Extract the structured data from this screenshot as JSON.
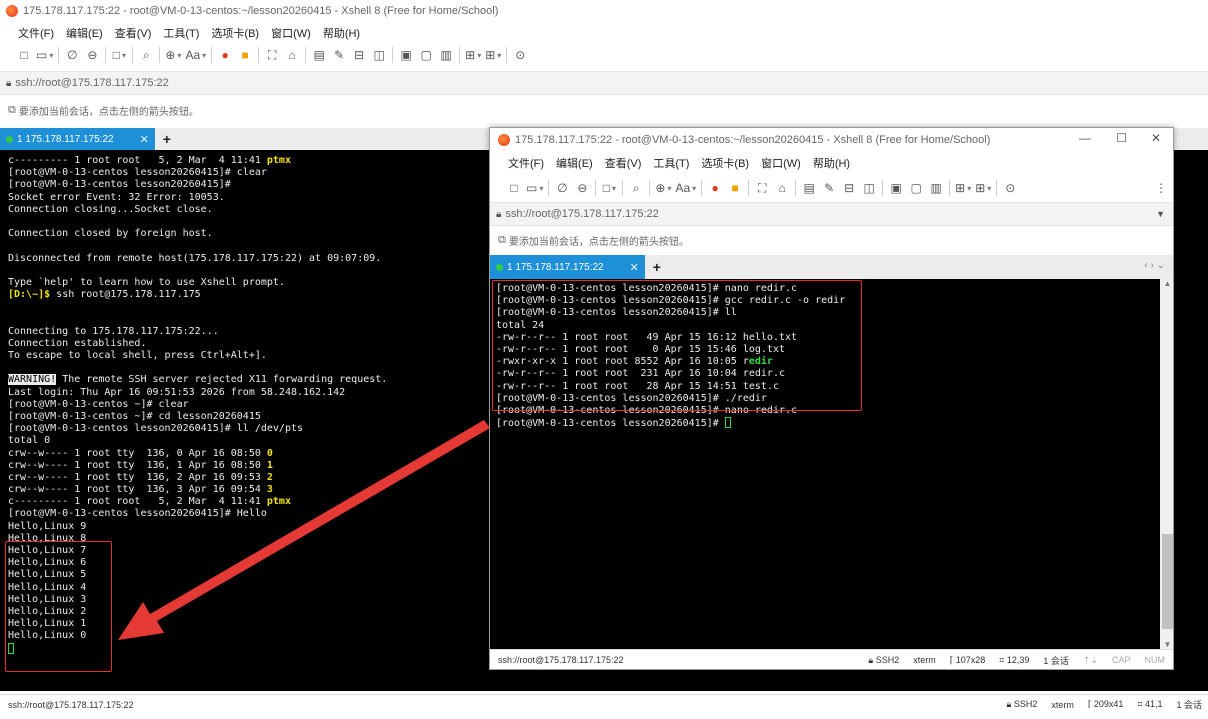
{
  "main_window": {
    "title": "175.178.117.175:22 - root@VM-0-13-centos:~/lesson20260415 - Xshell 8 (Free for Home/School)",
    "menu": [
      "文件(F)",
      "编辑(E)",
      "查看(V)",
      "工具(T)",
      "选项卡(B)",
      "窗口(W)",
      "帮助(H)"
    ],
    "address": "ssh://root@175.178.117.175:22",
    "hint": "要添加当前会话，点击左侧的箭头按钮。",
    "tab_label": "1 175.178.117.175:22",
    "terminal_lines": [
      "c--------- 1 root root   5, 2 Mar  4 11:41 ptmx",
      "[root@VM-0-13-centos lesson20260415]# clear",
      "[root@VM-0-13-centos lesson20260415]#",
      "Socket error Event: 32 Error: 10053.",
      "Connection closing...Socket close.",
      "",
      "Connection closed by foreign host.",
      "",
      "Disconnected from remote host(175.178.117.175:22) at 09:07:09.",
      "",
      "Type `help' to learn how to use Xshell prompt.",
      "[D:\\~]$ ssh root@175.178.117.175",
      "",
      "",
      "Connecting to 175.178.117.175:22...",
      "Connection established.",
      "To escape to local shell, press Ctrl+Alt+].",
      "",
      "WARNING! The remote SSH server rejected X11 forwarding request.",
      "Last login: Thu Apr 16 09:51:53 2026 from 58.248.162.142",
      "[root@VM-0-13-centos ~]# clear",
      "[root@VM-0-13-centos ~]# cd lesson20260415",
      "[root@VM-0-13-centos lesson20260415]# ll /dev/pts",
      "total 0",
      "crw--w---- 1 root tty  136, 0 Apr 16 08:50 0",
      "crw--w---- 1 root tty  136, 1 Apr 16 08:50 1",
      "crw--w---- 1 root tty  136, 2 Apr 16 09:53 2",
      "crw--w---- 1 root tty  136, 3 Apr 16 09:54 3",
      "c--------- 1 root root   5, 2 Mar  4 11:41 ptmx",
      "[root@VM-0-13-centos lesson20260415]# Hello",
      "Hello,Linux 9",
      "Hello,Linux 8",
      "Hello,Linux 7",
      "Hello,Linux 6",
      "Hello,Linux 5",
      "Hello,Linux 4",
      "Hello,Linux 3",
      "Hello,Linux 2",
      "Hello,Linux 1",
      "Hello,Linux 0"
    ],
    "status": {
      "address": "ssh://root@175.178.117.175:22",
      "protocol": "SSH2",
      "term_type": "xterm",
      "size": "209x41",
      "cursor_pos": "41,1",
      "sessions": "1 会话"
    }
  },
  "secondary_window": {
    "title": "175.178.117.175:22 - root@VM-0-13-centos:~/lesson20260415 - Xshell 8 (Free for Home/School)",
    "menu": [
      "文件(F)",
      "编辑(E)",
      "查看(V)",
      "工具(T)",
      "选项卡(B)",
      "窗口(W)",
      "帮助(H)"
    ],
    "address": "ssh://root@175.178.117.175:22",
    "hint": "要添加当前会话，点击左侧的箭头按钮。",
    "tab_label": "1 175.178.117.175:22",
    "terminal_lines": [
      "[root@VM-0-13-centos lesson20260415]# nano redir.c",
      "[root@VM-0-13-centos lesson20260415]# gcc redir.c -o redir",
      "[root@VM-0-13-centos lesson20260415]# ll",
      "total 24",
      "-rw-r--r-- 1 root root   49 Apr 15 16:12 hello.txt",
      "-rw-r--r-- 1 root root    0 Apr 15 15:46 log.txt",
      "-rwxr-xr-x 1 root root 8552 Apr 16 10:05 redir",
      "-rw-r--r-- 1 root root  231 Apr 16 10:04 redir.c",
      "-rw-r--r-- 1 root root   28 Apr 15 14:51 test.c",
      "[root@VM-0-13-centos lesson20260415]# ./redir",
      "[root@VM-0-13-centos lesson20260415]# nano redir.c",
      "[root@VM-0-13-centos lesson20260415]# "
    ],
    "status": {
      "address": "ssh://root@175.178.117.175:22",
      "protocol": "SSH2",
      "term_type": "xterm",
      "size": "107x28",
      "cursor_pos": "12,39",
      "sessions": "1 会话",
      "caps": "CAP",
      "num": "NUM"
    }
  },
  "colors": {
    "terminal_bg": "#000000",
    "terminal_fg": "#ececec",
    "highlight_yellow": "#f2e400",
    "highlight_green": "#36d94a",
    "tab_active": "#1e90d8",
    "annotation_red": "#e03030"
  },
  "icons": [
    "xshell-logo-icon",
    "new-session-icon",
    "open-folder-icon",
    "reconnect-icon",
    "disconnect-icon",
    "new-tab-icon",
    "search-icon",
    "globe-icon",
    "font-icon",
    "xftp-icon",
    "xmanager-icon",
    "fullscreen-icon",
    "lock-icon",
    "compose-icon",
    "log-icon",
    "script-icon",
    "keymap-icon",
    "layout-icon",
    "help-icon",
    "add-session-icon",
    "tab-add-icon",
    "tab-close-icon"
  ]
}
